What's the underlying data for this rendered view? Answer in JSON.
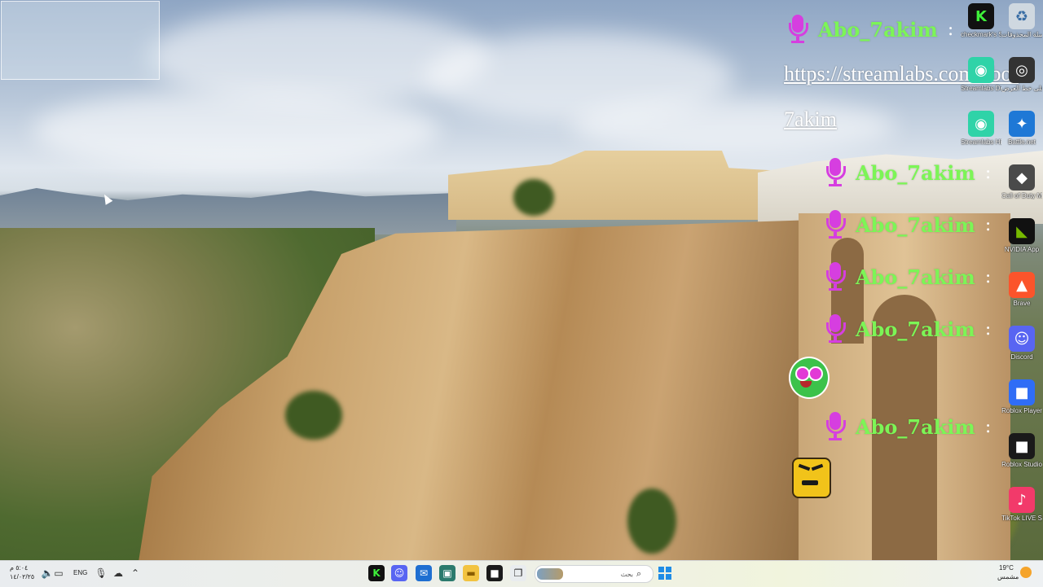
{
  "chat": {
    "lines": [
      {
        "user": "Abo_7akim",
        "sep": ":"
      },
      {
        "user": "Abo_7akim",
        "sep": ":"
      },
      {
        "user": "Abo_7akim",
        "sep": ":"
      },
      {
        "user": "Abo_7akim",
        "sep": ":"
      },
      {
        "user": "Abo_7akim",
        "sep": ":"
      },
      {
        "user": "Abo_7akim",
        "sep": ":"
      }
    ],
    "link_line1": "https://streamlabs.com/abo-",
    "link_line2": "7akim"
  },
  "desktop_icons": [
    {
      "label": "checkmark's Stream - ...",
      "glyph": "K",
      "color": "#111111",
      "fg": "#3ef03a"
    },
    {
      "label": "سلة المحذوفات",
      "glyph": "♻",
      "color": "#cfd8e0",
      "fg": "#3a6ea5"
    },
    {
      "label": "Streamlabs Desktop",
      "glyph": "◉",
      "color": "#2fd3a8",
      "fg": "#ffffff"
    },
    {
      "label": "تجربة على خط العرض",
      "glyph": "◎",
      "color": "#333333",
      "fg": "#ffffff"
    },
    {
      "label": "Streamlabs Highlighter",
      "glyph": "◉",
      "color": "#2fd3a8",
      "fg": "#ffffff"
    },
    {
      "label": "Battle.net",
      "glyph": "✦",
      "color": "#1e78d6",
      "fg": "#ffffff"
    },
    {
      "label": "Call of Duty Modern ...",
      "glyph": "◆",
      "color": "#4a4a4a",
      "fg": "#ffffff"
    },
    {
      "label": "NVIDIA App",
      "glyph": "◣",
      "color": "#111111",
      "fg": "#76b900"
    },
    {
      "label": "Brave",
      "glyph": "▲",
      "color": "#fb542b",
      "fg": "#ffffff"
    },
    {
      "label": "Discord",
      "glyph": "☺",
      "color": "#5865f2",
      "fg": "#ffffff"
    },
    {
      "label": "Roblox Player",
      "glyph": "■",
      "color": "#2f6df6",
      "fg": "#ffffff"
    },
    {
      "label": "Roblox Studio",
      "glyph": "■",
      "color": "#1a1a1a",
      "fg": "#ffffff"
    },
    {
      "label": "TikTok LIVE Studio",
      "glyph": "♪",
      "color": "#f23a6a",
      "fg": "#ffffff"
    }
  ],
  "taskbar": {
    "time": "٥:٠٤ م",
    "date": "١٤/٠٢/٢٥",
    "language": "ENG",
    "search_placeholder": "بحث",
    "temperature": "19°C",
    "weather_desc": "مشمس",
    "icons": [
      "volume-icon",
      "network-icon",
      "microphone-icon",
      "cloud-icon",
      "chevron-up-icon"
    ],
    "apps": [
      {
        "name": "stream-app",
        "glyph": "K",
        "color": "#111111",
        "fg": "#3ef03a"
      },
      {
        "name": "discord-app",
        "glyph": "☺",
        "color": "#5865f2",
        "fg": "#ffffff"
      },
      {
        "name": "mail-app",
        "glyph": "✉",
        "color": "#1f6fd1",
        "fg": "#ffffff"
      },
      {
        "name": "store-app",
        "glyph": "▣",
        "color": "#2b7a6d",
        "fg": "#ffffff"
      },
      {
        "name": "file-explorer-app",
        "glyph": "▬",
        "color": "#f2c341",
        "fg": "#8a5d00"
      },
      {
        "name": "roblox-studio-app",
        "glyph": "■",
        "color": "#1a1a1a",
        "fg": "#ffffff"
      },
      {
        "name": "task-view-app",
        "glyph": "❐",
        "color": "#e9ecef",
        "fg": "#222222"
      }
    ]
  }
}
